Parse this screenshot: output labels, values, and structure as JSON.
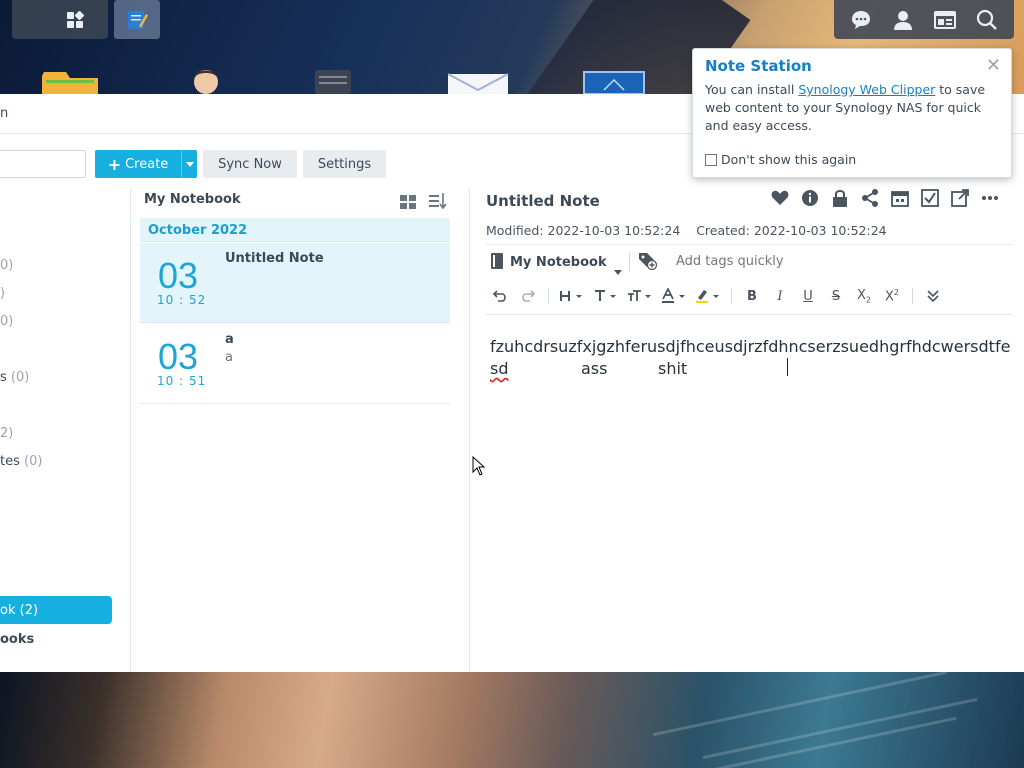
{
  "window": {
    "title_fragment": "n"
  },
  "toolbar": {
    "create_label": "Create",
    "sync_label": "Sync Now",
    "settings_label": "Settings"
  },
  "sidebar": {
    "items": [
      {
        "label": "0)"
      },
      {
        "label": ")"
      },
      {
        "label": "0)"
      },
      {
        "label": "s",
        "count": "(0)"
      },
      {
        "label": "2)"
      },
      {
        "label": "tes",
        "count": "(0)"
      }
    ],
    "active": {
      "label": "ok",
      "count": "(2)"
    },
    "section": "ooks"
  },
  "list": {
    "title": "My Notebook",
    "month": "October 2022",
    "notes": [
      {
        "day": "03",
        "time": "10 : 52",
        "title": "Untitled Note",
        "preview": ""
      },
      {
        "day": "03",
        "time": "10 : 51",
        "title": "a",
        "preview": "a"
      }
    ]
  },
  "editor": {
    "title": "Untitled Note",
    "modified": "Modified: 2022-10-03 10:52:24",
    "created": "Created: 2022-10-03 10:52:24",
    "notebook": "My Notebook",
    "tags_placeholder": "Add tags quickly",
    "content_line1": "fzuhcdrsuzfxjgzhferusdjfhceusdjrzfdhncserzsuedhgrfhdcwersdtfe",
    "content_line2": [
      "sd",
      "ass",
      "shit"
    ]
  },
  "popup": {
    "title": "Note Station",
    "text_before": "You can install ",
    "link": "Synology Web Clipper",
    "text_after": " to save web content to your Synology NAS for quick and easy access.",
    "checkbox_label": "Don't show this again"
  },
  "colors": {
    "accent": "#17aee0",
    "link": "#1780c4",
    "selected_bg": "#e3f4fb"
  }
}
